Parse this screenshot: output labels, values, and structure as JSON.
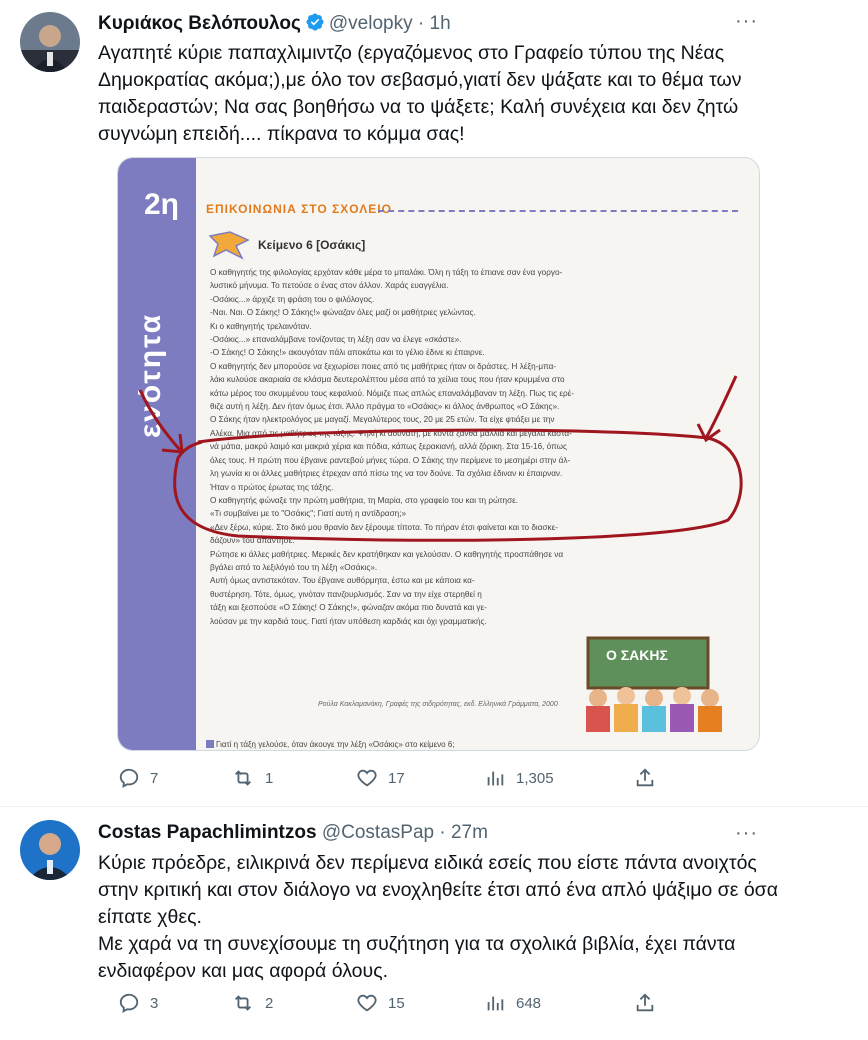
{
  "tweet1": {
    "author_name": "Κυριάκος Βελόπουλος",
    "handle": "@velopky",
    "dot": "·",
    "time": "1h",
    "more": "···",
    "text": "Αγαπητέ κύριε παπαχλιμιντζο (εργαζόμενος στο Γραφείο τύπου της Νέας Δημοκρατίας ακόμα;),με όλο τον σεβασμό,γιατί δεν ψάξατε και το θέμα των παιδεραστών; Να σας βοηθήσω να το ψάξετε; Καλή συνέχεια και δεν ζητώ συγνώμη επειδή.... πίκρανα το κόμμα σας!",
    "media": {
      "unit_number": "2η",
      "unit_word": "ενότητα",
      "section_title": "ΕΠΙΚΟΙΝΩΝΙΑ ΣΤΟ ΣΧΟΛΕΙΟ",
      "text_title": "Κείμενο 6  [Οσάκις]",
      "lines": [
        "Ο καθηγητής της φιλολογίας ερχόταν κάθε μέρα το μπαλάκι. Όλη η τάξη το έπιανε σαν ένα γοργο-",
        "λυστικό μήνυμα. Το πετούσε ο ένας στον άλλον. Χαράς ευαγγέλια.",
        "-Οσάκις...» άρχιζε τη φράση του ο φιλόλογος.",
        "-Ναι. Ναι. Ο Σάκης! Ο Σάκης!» φώναζαν όλες μαζί οι μαθήτριες γελώντας.",
        "Κι ο καθηγητής τρελαινόταν.",
        "-Οσάκις...» επαναλάμβανε τονίζοντας τη λέξη σαν να έλεγε «σκάστε».",
        "-Ο Σάκης! Ο Σάκης!» ακουγόταν πάλι αποκάτω και το γέλιο έδινε κι έπαιρνε.",
        "Ο καθηγητής δεν μπορούσε να ξεχωρίσει ποιες από τις μαθήτριες ήταν οι δράστες. Η λέξη-μπα-",
        "λάκι κυλούσε ακαριαία σε κλάσμα δευτερολέπτου μέσα από τα χείλια τους που ήταν κρυμμένα στο",
        "κάτω μέρος του σκυμμένου τους κεφαλιού. Νόμιζε πως απλώς επαναλάμβαναν τη λέξη. Πως τις ερέ-",
        "θιζε αυτή η λέξη. Δεν ήταν όμως έτσι. Άλλο πράγμα το «Οσάκις» κι άλλος άνθρωπος «Ο Σάκης».",
        "Ο Σάκης ήταν ηλεκτρολόγος με μαγαζί. Μεγαλύτερος τους, 20 με 25 ετών. Τα είχε φτιάξει με την",
        "Αλέκα. Μια από τις μαθήτριες της τάξης. Ψηλή κι αδύνατη, με κοντά ξανθά μαλλιά και μεγάλα καστα-",
        "νά μάτια, μακρύ λαιμό και μακριά χέρια και πόδια, κάπως ξερακιανή, αλλά ζόρικη. Στα 15-16, όπως",
        "όλες τους. Η πρώτη που έβγαινε ραντεβού μήνες τώρα. Ο Σάκης την περίμενε το μεσημέρι στην άλ-",
        "λη γωνία κι οι άλλες μαθήτριες έτρεχαν από πίσω της να τον δούνε. Τα σχόλια έδιναν κι έπαιρναν.",
        "Ήταν ο πρώτος έρωτας της τάξης.",
        "Ο καθηγητής φώναξε την πρώτη μαθήτρια, τη Μαρία, στο γραφείο του και τη ρώτησε.",
        "«Τι συμβαίνει με το \"Οσάκις\"; Γιατί αυτή η αντίδραση;»",
        "«Δεν ξέρω, κύριε. Στο δικό μου θρανίο δεν ξέρουμε τίποτα. Το πήραν έτσι φαίνεται και το διασκε-",
        "δάζουν» του απάντησε.",
        "Ρώτησε κι άλλες μαθήτριες. Μερικές δεν κρατήθηκαν και γελούσαν. Ο καθηγητής προσπάθησε να",
        "βγάλει από το λεξιλόγιό του τη λέξη «Οσάκις».",
        "Αυτή όμως αντιστεκόταν. Του έβγαινε αυθόρμητα, έστω και με κάποια κα-",
        "θυστέρηση. Τότε, όμως, γινόταν πανζουρλισμός. Σαν να την είχε στερηθεί η",
        "τάξη και ξεσπούσε «Ο Σάκης! Ο Σάκης!», φώναζαν ακόμα πιο δυνατά και γε-",
        "λούσαν με την καρδιά τους. Γιατί ήταν υπόθεση καρδιάς και όχι γραμματικής."
      ],
      "citation": "Ρούλα Κακλαμανάκη, Γραφές της σιδηρότητας, εκδ. Ελληνικά Γράμματα, 2000",
      "question": "Γιατί η τάξη γελούσε, όταν άκουγε την λέξη «Οσάκις» στο κείμενο 6;",
      "sign_text": "Ο ΣΑΚΗΣ"
    },
    "actions": {
      "replies": "7",
      "retweets": "1",
      "likes": "17",
      "views": "1,305"
    }
  },
  "tweet2": {
    "author_name": "Costas Papachlimintzos",
    "handle": "@CostasPap",
    "dot": "·",
    "time": "27m",
    "more": "···",
    "text1": "Κύριε πρόεδρε, ειλικρινά δεν περίμενα ειδικά εσείς που είστε πάντα ανοιχτός στην κριτική και στον διάλογο να ενοχληθείτε έτσι από ένα απλό ψάξιμο σε όσα είπατε χθες.",
    "text2": "Με χαρά να τη συνεχίσουμε τη συζήτηση για τα σχολικά βιβλία, έχει πάντα ενδιαφέρον και μας αφορά όλους.",
    "actions": {
      "replies": "3",
      "retweets": "2",
      "likes": "15",
      "views": "648"
    }
  },
  "colors": {
    "text": "#0f1419",
    "secondary": "#536471",
    "verified": "#1d9bf0",
    "book_purple": "#7d7cc0",
    "book_orange": "#e07c1f",
    "annotation_red": "#a0161e"
  }
}
